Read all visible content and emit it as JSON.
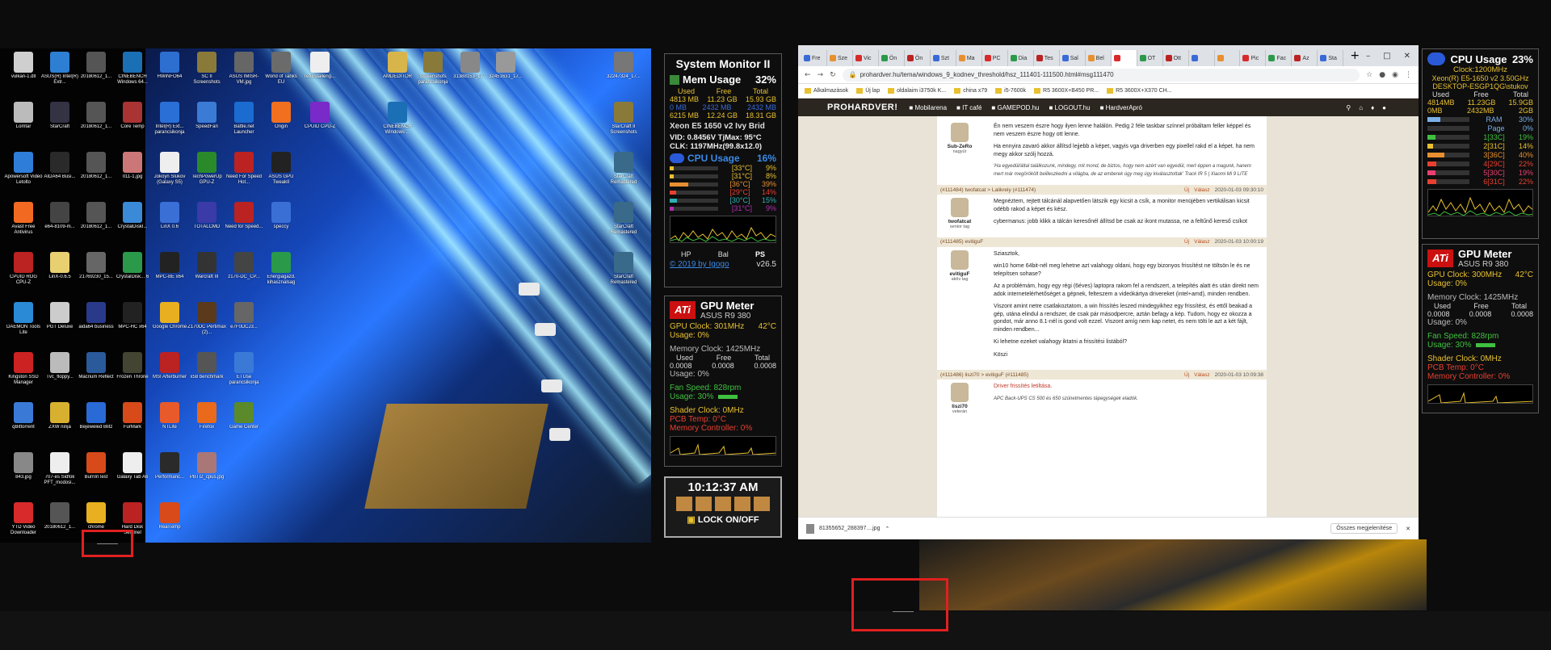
{
  "left_desktop": {
    "icons": [
      {
        "label": "vulkan-1.dll",
        "color": "#cfcfcf"
      },
      {
        "label": "ASUS(R) Intel(R) Extr...",
        "color": "#2d7fd3"
      },
      {
        "label": "20180612_1...",
        "color": "#555"
      },
      {
        "label": "CINEBENCH Windows 64...",
        "color": "#1b6fb5"
      },
      {
        "label": "HWiNFO64",
        "color": "#2d6fd1"
      },
      {
        "label": "SC II Screenshots",
        "color": "#8a7a3a"
      },
      {
        "label": "ASUS IMISR-VM.jpg",
        "color": "#666"
      },
      {
        "label": "World of Tanks EU",
        "color": "#6b6b6b"
      },
      {
        "label": "refundalleng...",
        "color": "#eee"
      },
      {
        "label": "AMDEDITOR",
        "color": "#d8b54a"
      },
      {
        "label": "Screenshots parancsikonja",
        "color": "#8a7a3a"
      },
      {
        "label": "31388153_17...",
        "color": "#888"
      },
      {
        "label": "32451631_17...",
        "color": "#999"
      },
      {
        "label": "32247324_17...",
        "color": "#777"
      },
      {
        "label": "Lomtar",
        "color": "#bbb"
      },
      {
        "label": "StarCraft",
        "color": "#334"
      },
      {
        "label": "20180612_1...",
        "color": "#555"
      },
      {
        "label": "Core Temp",
        "color": "#a33"
      },
      {
        "label": "Intel(R) Ext... parancsikonja",
        "color": "#2a6fd6"
      },
      {
        "label": "SpeedFan",
        "color": "#3a7bd5"
      },
      {
        "label": "Battle.net Launcher",
        "color": "#1a6cd0"
      },
      {
        "label": "Origin",
        "color": "#f07020"
      },
      {
        "label": "CPUID CPU-Z",
        "color": "#7a2ac8"
      },
      {
        "label": "CINEBENCH Windows ...",
        "color": "#1b6fb5"
      },
      {
        "label": "Apowersoft Video Letolto",
        "color": "#2e7dd8"
      },
      {
        "label": "AIDA64 Busi...",
        "color": "#2a2a2a"
      },
      {
        "label": "20180612_1...",
        "color": "#555"
      },
      {
        "label": "011-1.jpg",
        "color": "#c77"
      },
      {
        "label": "Jokoyn Slukov (Galaxy S5)",
        "color": "#eee"
      },
      {
        "label": "TechPowerUp GPU-Z",
        "color": "#2a8a2a"
      },
      {
        "label": "Need For Speed Hot...",
        "color": "#b22"
      },
      {
        "label": "ASUS GPU TweakII",
        "color": "#222"
      },
      {
        "label": "Avast Free Antivirus",
        "color": "#f26a21"
      },
      {
        "label": "e64-8109-m...",
        "color": "#444"
      },
      {
        "label": "20180612_1...",
        "color": "#555"
      },
      {
        "label": "CrystalDiskI...",
        "color": "#3a8ad8"
      },
      {
        "label": "LinX 0.6",
        "color": "#3a6fd6"
      },
      {
        "label": "TOTALCMD",
        "color": "#3a3aa8"
      },
      {
        "label": "Need for Speed...",
        "color": "#b22"
      },
      {
        "label": "speccy",
        "color": "#3a6fd6"
      },
      {
        "label": "CPUID ROG CPU-Z",
        "color": "#b22"
      },
      {
        "label": "LinX-0.6.5",
        "color": "#e8d070"
      },
      {
        "label": "21769230_15...",
        "color": "#666"
      },
      {
        "label": "CrystalDisk... 6",
        "color": "#2a9a4a"
      },
      {
        "label": "MPC-BE x64",
        "color": "#222"
      },
      {
        "label": "Warcraft III",
        "color": "#333"
      },
      {
        "label": "DAEMON Tools Lite",
        "color": "#2a8ad6"
      },
      {
        "label": "PGT Deluxe",
        "color": "#ccc"
      },
      {
        "label": "aida64 business",
        "color": "#2a3a8a"
      },
      {
        "label": "MPC-HC x64",
        "color": "#222"
      },
      {
        "label": "Google Chrome",
        "color": "#e8b020"
      },
      {
        "label": "Kingston SSD Manager",
        "color": "#c22"
      },
      {
        "label": "Tvc_floppy...",
        "color": "#bbb"
      },
      {
        "label": "Macrium Reflect",
        "color": "#2a5a9a"
      },
      {
        "label": "Frozen Throne",
        "color": "#443"
      },
      {
        "label": "MSI Afterburner",
        "color": "#b22"
      },
      {
        "label": "Z170DC Pertimax (2)...",
        "color": "#5a3a1a"
      },
      {
        "label": "z170-DC_CP...",
        "color": "#444"
      },
      {
        "label": "qBittorrent",
        "color": "#3a7ad6"
      },
      {
        "label": "ZXW ninja",
        "color": "#d8b030"
      },
      {
        "label": "Bejeweled Blitz",
        "color": "#2a6ad6"
      },
      {
        "label": "FurMark",
        "color": "#d84a1a"
      },
      {
        "label": "NTLite",
        "color": "#e85a2a"
      },
      {
        "label": "x58 benchmark",
        "color": "#555"
      },
      {
        "label": "e7F0DCJ3...",
        "color": "#666"
      },
      {
        "label": "843.jpg",
        "color": "#888"
      },
      {
        "label": "707-es Sidfok PFT_modosi...",
        "color": "#eee"
      },
      {
        "label": "BurnInTest",
        "color": "#d84a1a"
      },
      {
        "label": "Galaxy Tab A6",
        "color": "#eee"
      },
      {
        "label": "Performanc...",
        "color": "#2a2a2a"
      },
      {
        "label": "Firefox",
        "color": "#e86a1a"
      },
      {
        "label": "ETUse parancsikonja",
        "color": "#3a7ad6"
      },
      {
        "label": "YTD Video Downloader",
        "color": "#d82a2a"
      },
      {
        "label": "20180612_1...",
        "color": "#555"
      },
      {
        "label": "chrome",
        "color": "#e8b020"
      },
      {
        "label": "Hard Disk Sentinel",
        "color": "#b22"
      },
      {
        "label": "RealTemp",
        "color": "#d84a1a"
      },
      {
        "label": "PBTI2_cpus.jpg",
        "color": "#a77"
      },
      {
        "label": "Game Center",
        "color": "#5a8a2a"
      },
      {
        "label": "Energiagazd. kihasznalsag",
        "color": "#2a9a4a"
      },
      {
        "label": "StarCraft II Screenshots",
        "color": "#8a7a3a"
      },
      {
        "label": "StarCraft Remastered",
        "color": "#3a6a8a"
      },
      {
        "label": "StarCraft Remastered",
        "color": "#3a6a8a"
      },
      {
        "label": "StarCraft Remastered",
        "color": "#3a6a8a"
      }
    ]
  },
  "system_monitor": {
    "title": "System Monitor II",
    "mem_label": "Mem Usage",
    "mem_percent": "32%",
    "mem_header": [
      "Used",
      "Free",
      "Total"
    ],
    "mem_rows": [
      [
        "4813 MB",
        "11.23 GB",
        "15.93 GB"
      ],
      [
        "0 MB",
        "2432 MB",
        "2432 MB"
      ],
      [
        "6215 MB",
        "12.24 GB",
        "18.31 GB"
      ]
    ],
    "cpu_name": "Xeon E5 1650 v2 Ivy Brid",
    "vid": "VID: 0.8456V TjMax: 95°C",
    "clk": "CLK: 1197MHz(99.8x12.0)",
    "cpu_label": "CPU Usage",
    "cpu_percent": "16%",
    "cores": [
      {
        "temp": "[33°C]",
        "pct": "9%",
        "fill": 0.09,
        "color": "#e8c030"
      },
      {
        "temp": "[31°C]",
        "pct": "8%",
        "fill": 0.08,
        "color": "#e8c030"
      },
      {
        "temp": "[36°C]",
        "pct": "39%",
        "fill": 0.39,
        "color": "#e89030"
      },
      {
        "temp": "[29°C]",
        "pct": "14%",
        "fill": 0.14,
        "color": "#e84030"
      },
      {
        "temp": "[30°C]",
        "pct": "15%",
        "fill": 0.15,
        "color": "#30b0b0"
      },
      {
        "temp": "[31°C]",
        "pct": "9%",
        "fill": 0.09,
        "color": "#b030b0"
      }
    ],
    "footer_buttons": [
      "HP",
      "Bal",
      "PS"
    ],
    "copyright": "© 2019 by Igogo",
    "version": "v26.5"
  },
  "gpu_meter_left": {
    "title": "GPU Meter",
    "model": "ASUS R9 380",
    "gpu_clock": "GPU Clock: 301MHz",
    "gpu_temp": "42°C",
    "usage1": "Usage: 0%",
    "mem_clock": "Memory Clock: 1425MHz",
    "mem_header": [
      "Used",
      "Free",
      "Total"
    ],
    "mem_values": [
      "0.0008",
      "0.0008",
      "0.0008"
    ],
    "usage2": "Usage: 0%",
    "fan": "Fan Speed: 828rpm",
    "usage3": "Usage: 30%",
    "shader": "Shader Clock: 0MHz",
    "pcb": "PCB Temp: 0°C",
    "memctrl": "Memory Controller: 0%"
  },
  "clock_gadget": {
    "time": "10:12:37 AM",
    "lock_label": "LOCK ON/OFF"
  },
  "browser": {
    "tabs": [
      "Fre",
      "Sze",
      "Vic",
      "Ön",
      "Ön",
      "Szt",
      "Ma",
      "PC",
      "Dia",
      "Tes",
      "Sal",
      "Bel",
      "",
      "OT",
      "Ott",
      "",
      "",
      "Pic",
      "Fac",
      "Az",
      "Sta"
    ],
    "new_tab": "+",
    "url": "prohardver.hu/tema/windows_9_kodnev_threshold/hsz_111401-111500.html#msg111470",
    "bookmarks": [
      "Alkalmazások",
      "Új lap",
      "oldalaim i3750k K...",
      "china x79",
      "i5-7600k",
      "R5 3600X+B450 PR...",
      "R5 3600X+X370 CH..."
    ],
    "site_logo": "PROHARDVER!",
    "site_nav": [
      "Mobilarena",
      "IT café",
      "GAMEPOD.hu",
      "LOGOUT.hu",
      "HardverApró"
    ],
    "posts": [
      {
        "head": "",
        "date": "",
        "nick": "Sub-ZeRo",
        "rank": "nagyúr",
        "paras": [
          "Én nem veszem észre hogy ilyen lenne halálón. Pedig 2 féle taskbar színnel próbáltam feller képpel és nem veszem észre hogy ott lenne.",
          "Ha ennyira zavaró akkor állítsd lejjebb a képet, vagyis vga driverben egy pixellel rakd el a képet. ha nem megy akkor szólj hozzá."
        ],
        "sig": "'Ha egyedül/által találkozunk, mindegy, mit mond, de biztos, hogy nem azért van egyedül, mert éppen a magunk, hanem mert már megörökölt beilleszkedni a világba, de az emberek úgy meg úgy kiválasztottak' Track IR 5 | Xiaomi Mi 9 LITE"
      },
      {
        "head": "(#111484) twofatcat > Lalikrely (#111474)",
        "date": "2020-01-03 09:30:10",
        "nick": "twofatcat",
        "rank": "senior tag",
        "paras": [
          "Megnéztem, rejtett tálcánál alapvetően látszik egy kicsit a csík, a monitor menüjében vertikálisan kicsit odébb rakod a képet és kész.",
          "cybermanus: jobb klikk a tálcán keresőnél állítsd be csak az ikont mutassa, ne a feltűnő kereső csíkot"
        ],
        "sig": ""
      },
      {
        "head": "(#111485) evitiguF",
        "date": "2020-01-03 10:00:19",
        "nick": "evitiguF",
        "rank": "aktív tag",
        "paras": [
          "Sziasztok,",
          "win10 home 64bit-nél meg lehetne azt valahogy oldani, hogy egy bizonyos frissítést ne töltsön le és ne telepítsen sohase?",
          "Az a problémám, hogy egy régi (6éves) laptopra rakom fel a rendszert, a telepítés alatt és után direkt nem adok internetelérhetőséget a gépnek, felteszem a videókártya drivereket (intel+amd), minden rendben.",
          "Viszont amint netre csatlakoztatom, a win frissítés leszed mindegyikhez egy frissítést, és ettől beakad a gép, utána elindul a rendszer, de csak pár másodpercre, aztán befagy a kép. Tudom, hogy ez okozza a gondot, már anno 8.1-nél is gond volt ezzel. Viszont amíg nem kap netet, és nem tölti le azt a két fájlt, minden rendben...",
          "Ki lehetne ezeket valahogy iktatni a frissítési listából?",
          "Köszi"
        ],
        "sig": ""
      },
      {
        "head": "(#111486) liszi70 > evitiguF (#111485)",
        "date": "2020-01-03 10:09:38",
        "nick": "liszi70",
        "rank": "veterán",
        "paras": [
          "Driver frissítés letiltása."
        ],
        "sig": "APC Back-UPS CS 500 és 650 szünetmentes tápegységek eladók."
      }
    ],
    "reply_labels": [
      "Új",
      "Válasz"
    ],
    "download_file": "81355652_288397....jpg",
    "show_all": "Összes megjelenítése"
  },
  "cpu_right": {
    "title": "CPU Usage",
    "percent": "23%",
    "clock": "Clock:1200MHz",
    "cpu_name": "Xeon(R) E5-1650 v2 3.50GHz",
    "host": "DESKTOP-ESGP1QG\\stukov",
    "mem_header": [
      "Used",
      "Free",
      "Total"
    ],
    "mem_row1": [
      "4814MB",
      "11.23GB",
      "15.9GB"
    ],
    "mem_row2": [
      "0MB",
      "2432MB",
      "2GB"
    ],
    "rows": [
      {
        "label": "RAM",
        "pct": "30%",
        "fill": 0.3,
        "color": "#7ab0e8"
      },
      {
        "label": "Page",
        "pct": "0%",
        "fill": 0.0,
        "color": "#7ab0e8"
      },
      {
        "label": "1[33C]",
        "pct": "19%",
        "fill": 0.19,
        "color": "#40c040"
      },
      {
        "label": "2[31C]",
        "pct": "14%",
        "fill": 0.14,
        "color": "#e8c030"
      },
      {
        "label": "3[36C]",
        "pct": "40%",
        "fill": 0.4,
        "color": "#e89030"
      },
      {
        "label": "4[29C]",
        "pct": "22%",
        "fill": 0.22,
        "color": "#e84030"
      },
      {
        "label": "5[30C]",
        "pct": "19%",
        "fill": 0.19,
        "color": "#e84070"
      },
      {
        "label": "6[31C]",
        "pct": "22%",
        "fill": 0.22,
        "color": "#e84030"
      }
    ]
  },
  "gpu_meter_right": {
    "title": "GPU Meter",
    "model": "ASUS R9 380",
    "gpu_clock": "GPU Clock: 300MHz",
    "gpu_temp": "42°C",
    "usage1": "Usage: 0%",
    "mem_clock": "Memory Clock: 1425MHz",
    "mem_header": [
      "Used",
      "Free",
      "Total"
    ],
    "mem_values": [
      "0.0008",
      "0.0008",
      "0.0008"
    ],
    "usage2": "Usage: 0%",
    "fan": "Fan Speed: 828rpm",
    "usage3": "Usage: 30%",
    "shader": "Shader Clock: 0MHz",
    "pcb": "PCB Temp: 0°C",
    "memctrl": "Memory Controller: 0%"
  },
  "colors": {
    "red_box": "#e02020",
    "site_nav_bg": "#2c2620",
    "cpu_usage_blue": "#3a8ae8",
    "ati_red": "#cc1010"
  }
}
